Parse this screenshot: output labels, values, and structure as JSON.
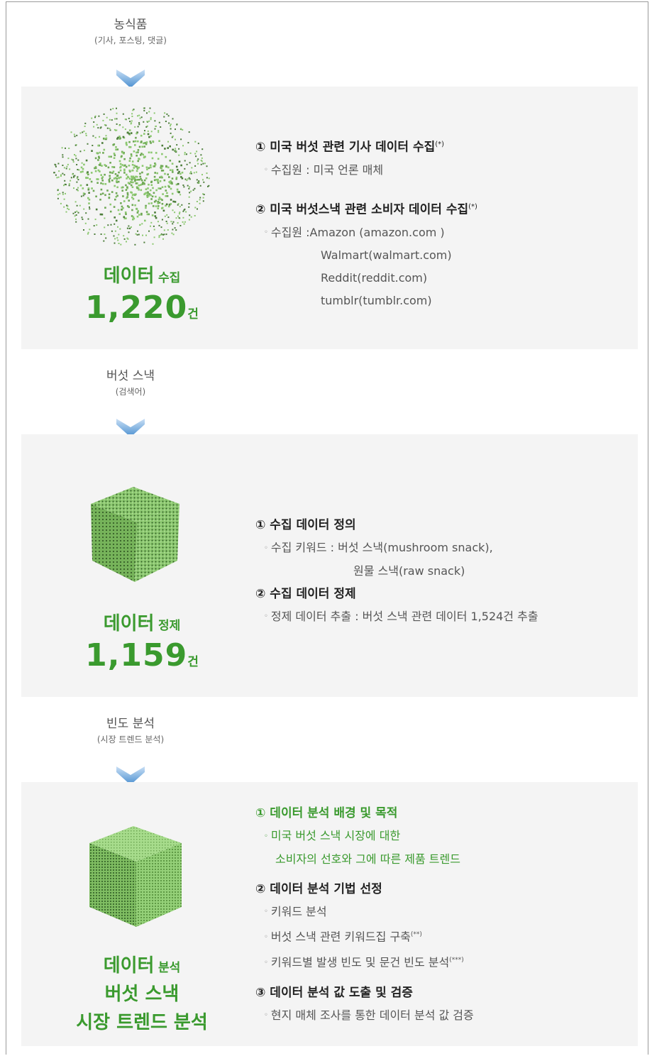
{
  "stage1": {
    "label": "농식품",
    "sub": "(기사, 포스팅, 댓글)",
    "title_big": "데이터",
    "title_small": "수집",
    "count": "1,220",
    "unit": "건",
    "items": [
      {
        "heading": "① 미국 버섯 관련 기사 데이터 수집",
        "mark": "(*)",
        "lines": [
          "수집원 : 미국 언론 매체"
        ]
      },
      {
        "heading": "② 미국 버섯스낵 관련 소비자 데이터 수집",
        "mark": "(*)",
        "lines": [
          "수집원 :Amazon (amazon.com )",
          "Walmart(walmart.com)",
          "Reddit(reddit.com)",
          "tumblr(tumblr.com)"
        ]
      }
    ]
  },
  "stage2": {
    "label": "버섯 스낵",
    "sub": "(검색어)",
    "title_big": "데이터",
    "title_small": "정제",
    "count": "1,159",
    "unit": "건",
    "items": [
      {
        "heading": "① 수집 데이터 정의",
        "lines": [
          "수집 키워드 :  버섯 스낵(mushroom snack),",
          "원물 스낵(raw snack)"
        ]
      },
      {
        "heading": "② 수집 데이터 정제",
        "lines": [
          "정제 데이터 추출 : 버섯 스낵 관련 데이터 1,524건 추출"
        ]
      }
    ]
  },
  "stage3": {
    "label": "빈도 분석",
    "sub": "(시장 트렌드 분석)",
    "title_big": "데이터",
    "title_small": "분석",
    "title_line2": "버섯 스낵",
    "title_line3": "시장 트렌드 분석",
    "items": [
      {
        "heading": "① 데이터 분석 배경 및 목적",
        "lines": [
          "미국 버섯 스낵 시장에 대한",
          "소비자의 선호와 그에 따른 제품 트렌드"
        ]
      },
      {
        "heading": "② 데이터 분석 기법 선정",
        "lines": [
          "키워드 분석",
          "버섯 스낵 관련 키워드집 구축",
          "키워드별 발생 빈도 및 문건 빈도 분석"
        ],
        "marks": [
          "",
          "(**)",
          "(***)"
        ]
      },
      {
        "heading": "③ 데이터 분석 값 도출 및 검증",
        "lines": [
          "현지 매체 조사를 통한 데이터 분석 값 검증"
        ]
      }
    ]
  },
  "colors": {
    "accent_green": "#3a9a2e",
    "band_bg": "#f4f4f4",
    "arrow_blue": "#4a8fd0",
    "cube_green": "#8cc870"
  }
}
